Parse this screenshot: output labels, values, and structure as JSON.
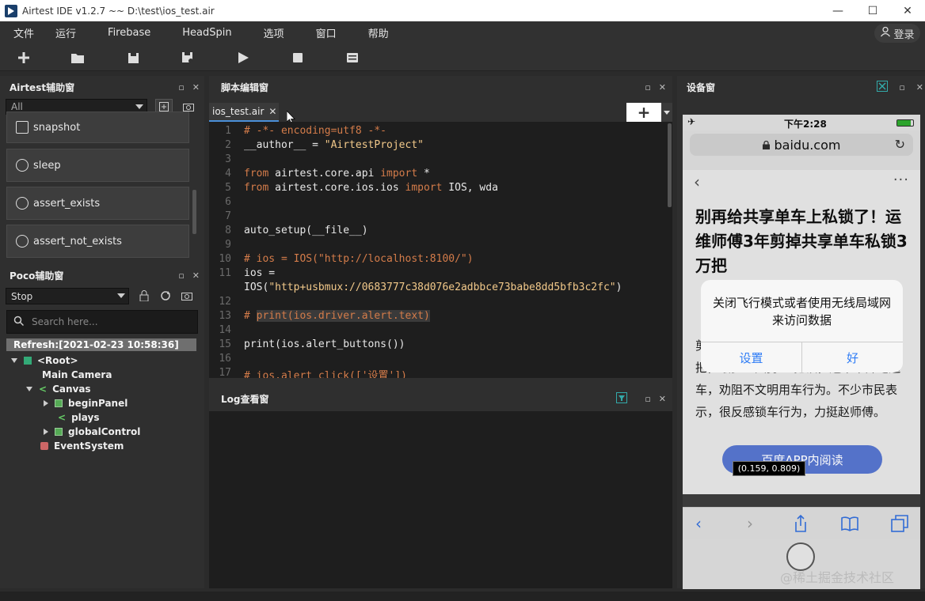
{
  "window": {
    "title": "Airtest IDE v1.2.7 ~~ D:\\test\\ios_test.air",
    "minimize": "—",
    "maximize": "☐",
    "close": "✕"
  },
  "menu": {
    "items": [
      "文件",
      "运行",
      "Firebase",
      "HeadSpin",
      "选项",
      "窗口",
      "帮助"
    ],
    "login": "登录"
  },
  "airtest_panel": {
    "title": "Airtest辅助窗",
    "filter_value": "All",
    "api_buttons": [
      "snapshot",
      "sleep",
      "assert_exists",
      "assert_not_exists"
    ]
  },
  "poco_panel": {
    "title": "Poco辅助窗",
    "mode_value": "Stop",
    "search_placeholder": "Search here...",
    "refresh": "Refresh:[2021-02-23 10:58:36]",
    "tree": [
      "<Root>",
      "Main Camera",
      "Canvas",
      "beginPanel",
      "plays",
      "globalControl",
      "EventSystem"
    ]
  },
  "editor_panel": {
    "title": "脚本编辑窗",
    "tab_name": "ios_test.air",
    "tab_close": "✕",
    "line_numbers": [
      "1",
      "2",
      "3",
      "4",
      "5",
      "6",
      "7",
      "8",
      "9",
      "10",
      "11",
      "",
      "12",
      "13",
      "14",
      "15",
      "16",
      "17"
    ]
  },
  "log_panel": {
    "title": "Log查看窗"
  },
  "device_panel": {
    "title": "设备窗",
    "status_time": "下午2:28",
    "url": "baidu.com",
    "headline": "别再给共享单车上私锁了！运维师傅3年剪掉共享单车私锁3万把",
    "body_text": "剪私锁。3年来，赵师傅已剪锁近3万把，最多一天剪45把锁，还常常奔跑追车，劝阻不文明用车行为。不少市民表示，很反感锁车行为，力挺赵师傅。",
    "alert_message": "关闭飞行模式或者使用无线局域网来访问数据",
    "alert_btn_settings": "设置",
    "alert_btn_ok": "好",
    "read_in_app": "百度APP内阅读",
    "tooltip": "(0.159, 0.809)"
  },
  "watermark": "@稀土掘金技术社区",
  "colors": {
    "accent": "#4a8fd8",
    "ios_blue": "#2e7cf6",
    "comment": "#d47c4a",
    "string": "#f2c98a"
  }
}
